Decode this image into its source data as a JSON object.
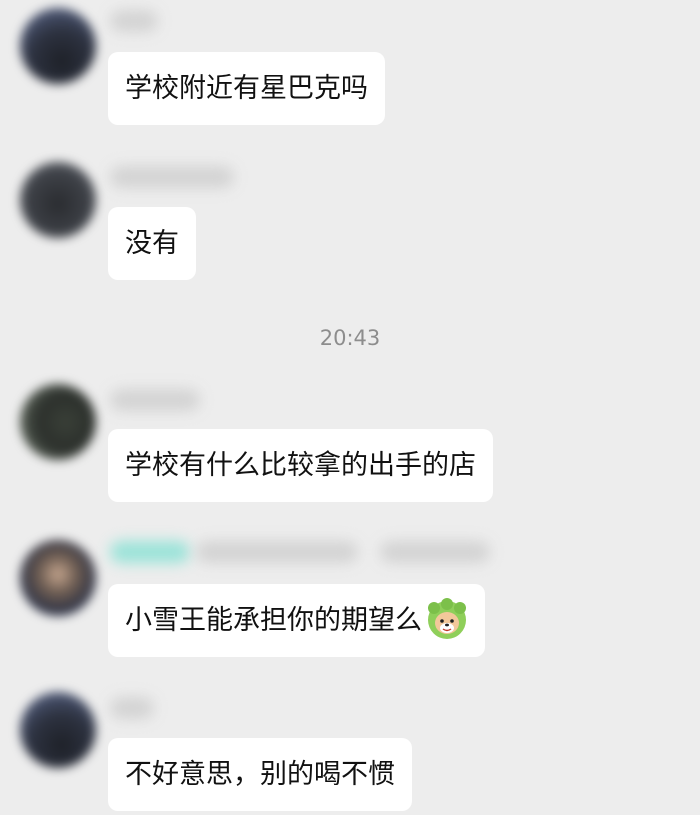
{
  "colors": {
    "background": "#ededed",
    "bubble": "#ffffff",
    "timestamp_text": "#8d8d8d",
    "username_highlight": "#7fe0d2"
  },
  "timestamp": "20:43",
  "messages": [
    {
      "text": "学校附近有星巴克吗"
    },
    {
      "text": "没有"
    },
    {
      "text": "学校有什么比较拿的出手的店"
    },
    {
      "text": "小雪王能承担你的期望么",
      "emoji": "green-hooded-dog-emoji"
    },
    {
      "text": "不好意思，别的喝不惯"
    }
  ]
}
